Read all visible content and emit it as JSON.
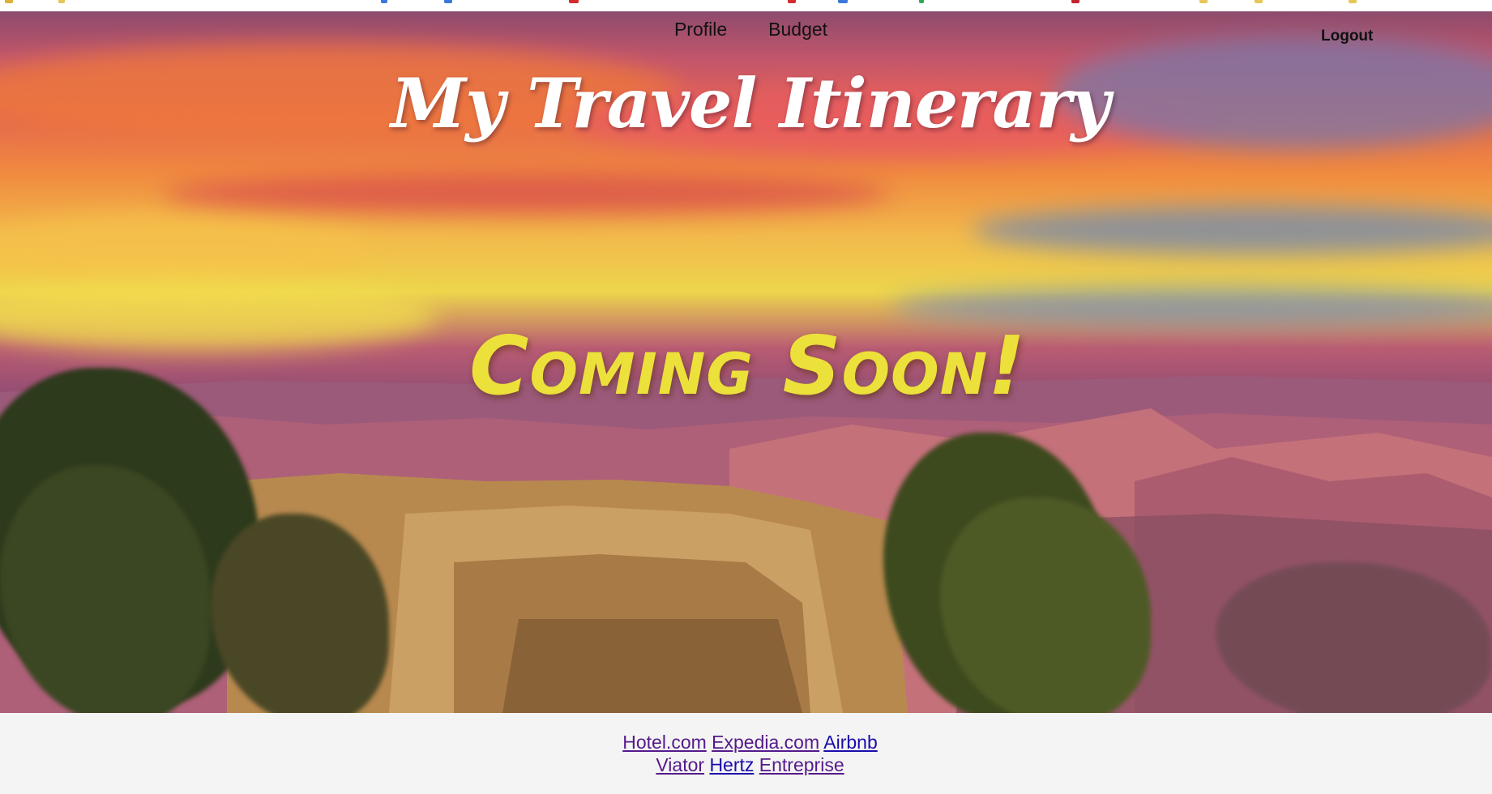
{
  "nav": {
    "profile_label": "Profile",
    "budget_label": "Budget",
    "logout_label": "Logout"
  },
  "hero": {
    "title": "My Travel Itinerary",
    "subtitle": "Coming Soon!"
  },
  "footer": {
    "row1": [
      {
        "label": "Hotel.com",
        "color": "#551a8b"
      },
      {
        "label": "Expedia.com",
        "color": "#551a8b"
      },
      {
        "label": "Airbnb",
        "color": "#1a0dab"
      }
    ],
    "row2": [
      {
        "label": "Viator",
        "color": "#551a8b"
      },
      {
        "label": "Hertz",
        "color": "#1a0dab"
      },
      {
        "label": "Entreprise",
        "color": "#551a8b"
      }
    ]
  },
  "colors": {
    "title_text": "#ffffff",
    "coming_soon_text": "#ece13a",
    "nav_text": "#111111",
    "footer_bg": "#f4f4f4",
    "visited_link": "#551a8b",
    "unvisited_link": "#1a0dab"
  }
}
